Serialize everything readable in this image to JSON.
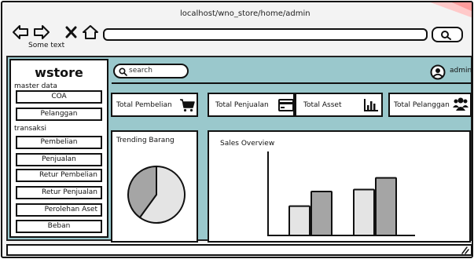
{
  "browser": {
    "url": "localhost/wno_store/home/admin",
    "caption": "Some text"
  },
  "sidebar": {
    "brand": "wstore",
    "master_label": "master data",
    "master_items": [
      {
        "label": "COA"
      },
      {
        "label": "Pelanggan"
      }
    ],
    "transaksi_label": "transaksi",
    "transaksi_items": [
      {
        "label": "Pembelian"
      },
      {
        "label": "Penjualan"
      },
      {
        "label": "Retur Pembelian"
      },
      {
        "label": "Retur Penjualan"
      },
      {
        "label": "Perolehan Aset"
      },
      {
        "label": "Beban"
      }
    ]
  },
  "header": {
    "search_placeholder": "search",
    "user": "admin"
  },
  "cards": [
    {
      "label": "Total Pembelian",
      "icon": "cart-icon"
    },
    {
      "label": "Total Penjualan",
      "icon": "credit-card-icon"
    },
    {
      "label": "Total Asset",
      "icon": "bar-chart-icon"
    },
    {
      "label": "Total Pelanggan",
      "icon": "users-icon"
    }
  ],
  "trending": {
    "title": "Trending Barang"
  },
  "sales": {
    "title": "Sales Overview"
  },
  "chart_data": [
    {
      "type": "pie",
      "values": [
        60,
        40
      ],
      "colors": [
        "#e4e4e4",
        "#a5a5a5"
      ]
    },
    {
      "type": "bar",
      "categories": [
        "",
        ""
      ],
      "series": [
        {
          "values": [
            30,
            47
          ],
          "color": "#e4e4e4"
        },
        {
          "values": [
            45,
            59
          ],
          "color": "#a5a5a5"
        }
      ],
      "ylim": [
        0,
        86
      ]
    }
  ]
}
